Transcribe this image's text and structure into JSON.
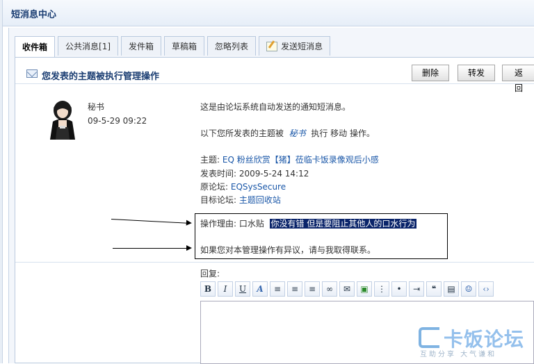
{
  "window": {
    "title": "短消息中心"
  },
  "tabs": [
    {
      "label": "收件箱",
      "active": true
    },
    {
      "label": "公共消息[1]",
      "active": false
    },
    {
      "label": "发件箱",
      "active": false
    },
    {
      "label": "草稿箱",
      "active": false
    },
    {
      "label": "忽略列表",
      "active": false
    },
    {
      "label": "发送短消息",
      "active": false,
      "icon": "compose-icon"
    }
  ],
  "message": {
    "subject": "您发表的主题被执行管理操作",
    "actions": {
      "delete": "删除",
      "forward": "转发",
      "back": "返回"
    },
    "sender": "秘书",
    "sent_time": "09-5-29 09:22",
    "line1": "这是由论坛系统自动发送的通知短消息。",
    "line2_prefix": "以下您所发表的主题被",
    "line2_moderator": "秘书",
    "line2_suffix": "执行  移动  操作。",
    "topic_label": "主题: ",
    "topic_value": "EQ 粉丝欣赏【猪】莅临卡饭录像观后小感",
    "post_time_label": "发表时间: ",
    "post_time_value": "2009-5-24 14:12",
    "origin_label": "原论坛: ",
    "origin_value": "EQSysSecure",
    "target_label": "目标论坛: ",
    "target_value": "主题回收站",
    "reason_label": "操作理由: 口水贴",
    "reason_highlight": "你没有错 但是要阻止其他人的口水行为",
    "contact_line": "如果您对本管理操作有异议，请与我取得联系。"
  },
  "reply": {
    "label": "回复:"
  },
  "toolbar_icons": [
    "bold-icon",
    "italic-icon",
    "underline-icon",
    "font-color-icon",
    "align-left-icon",
    "align-center-icon",
    "align-right-icon",
    "link-icon",
    "email-icon",
    "image-icon",
    "ordered-list-icon",
    "unordered-list-icon",
    "indent-icon",
    "quote-icon",
    "code-block-icon",
    "emoticon-icon",
    "source-code-icon"
  ],
  "watermark": {
    "main": "卡饭论坛",
    "sub": "互助分享 大气谦和"
  },
  "colors": {
    "link": "#1a57a8",
    "title": "#1a3d72",
    "highlight_bg": "#0a246a"
  }
}
